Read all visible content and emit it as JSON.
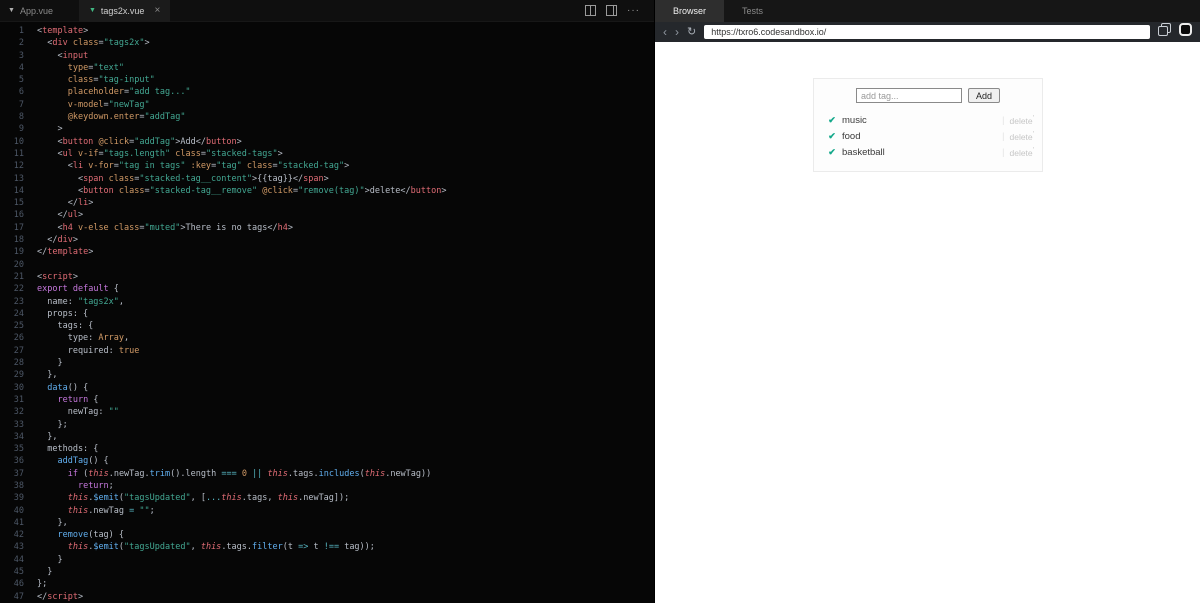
{
  "colors": {
    "accent_teal": "#13a88a",
    "vue_green": "#41b883",
    "syntax_tag": "#e06c75",
    "syntax_attr": "#d19a66",
    "syntax_string": "#43a893",
    "syntax_keyword": "#c678dd",
    "syntax_function": "#61afef",
    "syntax_operator": "#56b6c2",
    "editor_bg": "#060606"
  },
  "icons": {
    "vue_logo": "▼",
    "close": "×",
    "more": "···",
    "back": "‹",
    "forward": "›",
    "refresh": "↻",
    "check": "✔",
    "divider": "|"
  },
  "editor": {
    "tabs": {
      "app": "App.vue",
      "active": "tags2x.vue",
      "close": "×"
    },
    "lines": [
      [
        [
          "pl",
          "<"
        ],
        [
          "tg",
          "template"
        ],
        [
          "pl",
          ">"
        ]
      ],
      [
        [
          "pl",
          "  <"
        ],
        [
          "tg",
          "div"
        ],
        [
          "pl",
          " "
        ],
        [
          "at",
          "class"
        ],
        [
          "pl",
          "="
        ],
        [
          "st",
          "\"tags2x\""
        ],
        [
          "pl",
          ">"
        ]
      ],
      [
        [
          "pl",
          "    <"
        ],
        [
          "tg",
          "input"
        ]
      ],
      [
        [
          "pl",
          "      "
        ],
        [
          "at",
          "type"
        ],
        [
          "pl",
          "="
        ],
        [
          "st",
          "\"text\""
        ]
      ],
      [
        [
          "pl",
          "      "
        ],
        [
          "at",
          "class"
        ],
        [
          "pl",
          "="
        ],
        [
          "st",
          "\"tag-input\""
        ]
      ],
      [
        [
          "pl",
          "      "
        ],
        [
          "at",
          "placeholder"
        ],
        [
          "pl",
          "="
        ],
        [
          "st",
          "\"add tag...\""
        ]
      ],
      [
        [
          "pl",
          "      "
        ],
        [
          "at",
          "v-model"
        ],
        [
          "pl",
          "="
        ],
        [
          "st",
          "\"newTag\""
        ]
      ],
      [
        [
          "pl",
          "      "
        ],
        [
          "at",
          "@keydown.enter"
        ],
        [
          "pl",
          "="
        ],
        [
          "st",
          "\"addTag\""
        ]
      ],
      [
        [
          "pl",
          "    >"
        ]
      ],
      [
        [
          "pl",
          "    <"
        ],
        [
          "tg",
          "button"
        ],
        [
          "pl",
          " "
        ],
        [
          "at",
          "@click"
        ],
        [
          "pl",
          "="
        ],
        [
          "st",
          "\"addTag\""
        ],
        [
          "pl",
          ">Add</"
        ],
        [
          "tg",
          "button"
        ],
        [
          "pl",
          ">"
        ]
      ],
      [
        [
          "pl",
          "    <"
        ],
        [
          "tg",
          "ul"
        ],
        [
          "pl",
          " "
        ],
        [
          "at",
          "v-if"
        ],
        [
          "pl",
          "="
        ],
        [
          "st",
          "\"tags.length\""
        ],
        [
          "pl",
          " "
        ],
        [
          "at",
          "class"
        ],
        [
          "pl",
          "="
        ],
        [
          "st",
          "\"stacked-tags\""
        ],
        [
          "pl",
          ">"
        ]
      ],
      [
        [
          "pl",
          "      <"
        ],
        [
          "tg",
          "li"
        ],
        [
          "pl",
          " "
        ],
        [
          "at",
          "v-for"
        ],
        [
          "pl",
          "="
        ],
        [
          "st",
          "\"tag in tags\""
        ],
        [
          "pl",
          " "
        ],
        [
          "at",
          ":key"
        ],
        [
          "pl",
          "="
        ],
        [
          "st",
          "\"tag\""
        ],
        [
          "pl",
          " "
        ],
        [
          "at",
          "class"
        ],
        [
          "pl",
          "="
        ],
        [
          "st",
          "\"stacked-tag\""
        ],
        [
          "pl",
          ">"
        ]
      ],
      [
        [
          "pl",
          "        <"
        ],
        [
          "tg",
          "span"
        ],
        [
          "pl",
          " "
        ],
        [
          "at",
          "class"
        ],
        [
          "pl",
          "="
        ],
        [
          "st",
          "\"stacked-tag__content\""
        ],
        [
          "pl",
          ">{{tag}}</"
        ],
        [
          "tg",
          "span"
        ],
        [
          "pl",
          ">"
        ]
      ],
      [
        [
          "pl",
          "        <"
        ],
        [
          "tg",
          "button"
        ],
        [
          "pl",
          " "
        ],
        [
          "at",
          "class"
        ],
        [
          "pl",
          "="
        ],
        [
          "st",
          "\"stacked-tag__remove\""
        ],
        [
          "pl",
          " "
        ],
        [
          "at",
          "@click"
        ],
        [
          "pl",
          "="
        ],
        [
          "st",
          "\"remove(tag)\""
        ],
        [
          "pl",
          ">delete</"
        ],
        [
          "tg",
          "button"
        ],
        [
          "pl",
          ">"
        ]
      ],
      [
        [
          "pl",
          "      </"
        ],
        [
          "tg",
          "li"
        ],
        [
          "pl",
          ">"
        ]
      ],
      [
        [
          "pl",
          "    </"
        ],
        [
          "tg",
          "ul"
        ],
        [
          "pl",
          ">"
        ]
      ],
      [
        [
          "pl",
          "    <"
        ],
        [
          "tg",
          "h4"
        ],
        [
          "pl",
          " "
        ],
        [
          "at",
          "v-else"
        ],
        [
          "pl",
          " "
        ],
        [
          "at",
          "class"
        ],
        [
          "pl",
          "="
        ],
        [
          "st",
          "\"muted\""
        ],
        [
          "pl",
          ">There is no tags</"
        ],
        [
          "tg",
          "h4"
        ],
        [
          "pl",
          ">"
        ]
      ],
      [
        [
          "pl",
          "  </"
        ],
        [
          "tg",
          "div"
        ],
        [
          "pl",
          ">"
        ]
      ],
      [
        [
          "pl",
          "</"
        ],
        [
          "tg",
          "template"
        ],
        [
          "pl",
          ">"
        ]
      ],
      [],
      [
        [
          "pl",
          "<"
        ],
        [
          "tg",
          "script"
        ],
        [
          "pl",
          ">"
        ]
      ],
      [
        [
          "kw",
          "export"
        ],
        [
          "pl",
          " "
        ],
        [
          "kw",
          "default"
        ],
        [
          "pl",
          " {"
        ]
      ],
      [
        [
          "pl",
          "  name: "
        ],
        [
          "st",
          "\"tags2x\""
        ],
        [
          "pl",
          ","
        ]
      ],
      [
        [
          "pl",
          "  props: {"
        ]
      ],
      [
        [
          "pl",
          "    tags: {"
        ]
      ],
      [
        [
          "pl",
          "      type: "
        ],
        [
          "nm",
          "Array"
        ],
        [
          "pl",
          ","
        ]
      ],
      [
        [
          "pl",
          "      required: "
        ],
        [
          "nm",
          "true"
        ]
      ],
      [
        [
          "pl",
          "    }"
        ]
      ],
      [
        [
          "pl",
          "  },"
        ]
      ],
      [
        [
          "pl",
          "  "
        ],
        [
          "fn",
          "data"
        ],
        [
          "pl",
          "() {"
        ]
      ],
      [
        [
          "pl",
          "    "
        ],
        [
          "kw",
          "return"
        ],
        [
          "pl",
          " {"
        ]
      ],
      [
        [
          "pl",
          "      newTag: "
        ],
        [
          "st",
          "\"\""
        ]
      ],
      [
        [
          "pl",
          "    };"
        ]
      ],
      [
        [
          "pl",
          "  },"
        ]
      ],
      [
        [
          "pl",
          "  methods: {"
        ]
      ],
      [
        [
          "pl",
          "    "
        ],
        [
          "fn",
          "addTag"
        ],
        [
          "pl",
          "() {"
        ]
      ],
      [
        [
          "pl",
          "      "
        ],
        [
          "kw",
          "if"
        ],
        [
          "pl",
          " ("
        ],
        [
          "th",
          "this"
        ],
        [
          "pl",
          ".newTag."
        ],
        [
          "fn",
          "trim"
        ],
        [
          "pl",
          "().length "
        ],
        [
          "op",
          "==="
        ],
        [
          "pl",
          " "
        ],
        [
          "nm",
          "0"
        ],
        [
          "pl",
          " "
        ],
        [
          "op",
          "||"
        ],
        [
          "pl",
          " "
        ],
        [
          "th",
          "this"
        ],
        [
          "pl",
          ".tags."
        ],
        [
          "fn",
          "includes"
        ],
        [
          "pl",
          "("
        ],
        [
          "th",
          "this"
        ],
        [
          "pl",
          ".newTag))"
        ]
      ],
      [
        [
          "pl",
          "        "
        ],
        [
          "kw",
          "return"
        ],
        [
          "pl",
          ";"
        ]
      ],
      [
        [
          "pl",
          "      "
        ],
        [
          "th",
          "this"
        ],
        [
          "pl",
          "."
        ],
        [
          "fn",
          "$emit"
        ],
        [
          "pl",
          "("
        ],
        [
          "st",
          "\"tagsUpdated\""
        ],
        [
          "pl",
          ", ["
        ],
        [
          "op",
          "..."
        ],
        [
          "th",
          "this"
        ],
        [
          "pl",
          ".tags, "
        ],
        [
          "th",
          "this"
        ],
        [
          "pl",
          ".newTag]);"
        ]
      ],
      [
        [
          "pl",
          "      "
        ],
        [
          "th",
          "this"
        ],
        [
          "pl",
          ".newTag "
        ],
        [
          "op",
          "="
        ],
        [
          "pl",
          " "
        ],
        [
          "st",
          "\"\""
        ],
        [
          "pl",
          ";"
        ]
      ],
      [
        [
          "pl",
          "    },"
        ]
      ],
      [
        [
          "pl",
          "    "
        ],
        [
          "fn",
          "remove"
        ],
        [
          "pl",
          "(tag) {"
        ]
      ],
      [
        [
          "pl",
          "      "
        ],
        [
          "th",
          "this"
        ],
        [
          "pl",
          "."
        ],
        [
          "fn",
          "$emit"
        ],
        [
          "pl",
          "("
        ],
        [
          "st",
          "\"tagsUpdated\""
        ],
        [
          "pl",
          ", "
        ],
        [
          "th",
          "this"
        ],
        [
          "pl",
          ".tags."
        ],
        [
          "fn",
          "filter"
        ],
        [
          "pl",
          "(t "
        ],
        [
          "op",
          "=>"
        ],
        [
          "pl",
          " t "
        ],
        [
          "op",
          "!=="
        ],
        [
          "pl",
          " tag));"
        ]
      ],
      [
        [
          "pl",
          "    }"
        ]
      ],
      [
        [
          "pl",
          "  }"
        ]
      ],
      [
        [
          "pl",
          "};"
        ]
      ],
      [
        [
          "pl",
          "</"
        ],
        [
          "tg",
          "script"
        ],
        [
          "pl",
          ">"
        ]
      ]
    ]
  },
  "preview": {
    "header_tabs": [
      {
        "label": "Browser"
      },
      {
        "label": "Tests"
      }
    ],
    "url": "https://txro6.codesandbox.io/",
    "app": {
      "placeholder": "add tag...",
      "add_button": "Add",
      "tags": [
        "music",
        "food",
        "basketball"
      ],
      "delete_label": "delete",
      "delete_suffix": "'"
    }
  }
}
